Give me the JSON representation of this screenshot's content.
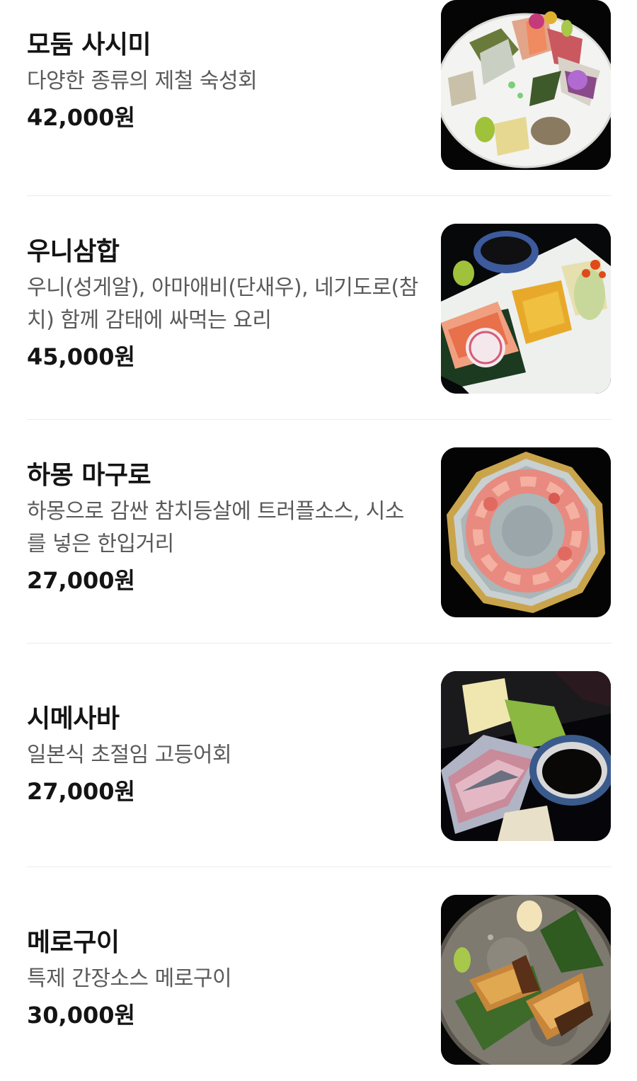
{
  "menu": {
    "items": [
      {
        "name": "모둠 사시미",
        "description": "다양한 종류의 제철 숙성회",
        "price": "42,000원",
        "image_icon": "assorted-sashimi-plate-image"
      },
      {
        "name": "우니삼합",
        "description": "우니(성게알), 아마애비(단새우), 네기도로(참치) 함께 감태에 싸먹는 요리",
        "price": "45,000원",
        "image_icon": "uni-samhap-plate-image"
      },
      {
        "name": "하몽 마구로",
        "description": "하몽으로 감싼 참치등살에 트러플소스, 시소를 넣은 한입거리",
        "price": "27,000원",
        "image_icon": "jamon-maguro-plate-image"
      },
      {
        "name": "시메사바",
        "description": "일본식 초절임 고등어회",
        "price": "27,000원",
        "image_icon": "shime-saba-plate-image"
      },
      {
        "name": "메로구이",
        "description": "특제 간장소스 메로구이",
        "price": "30,000원",
        "image_icon": "grilled-mero-plate-image"
      }
    ]
  }
}
